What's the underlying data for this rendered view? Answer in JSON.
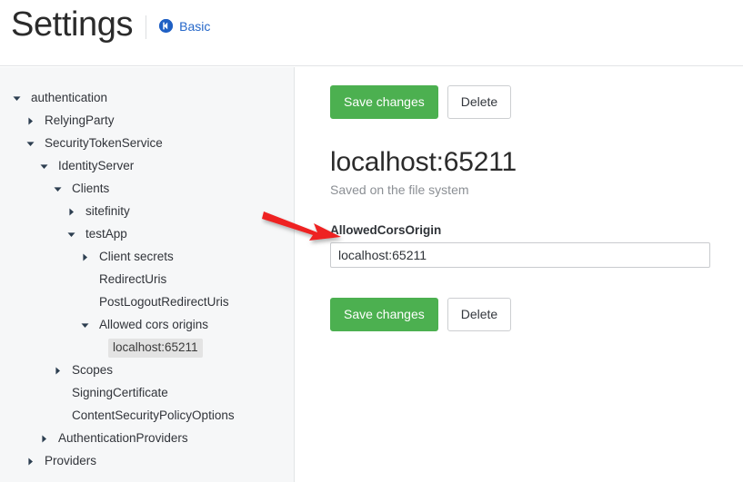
{
  "header": {
    "title": "Settings",
    "back_link": {
      "label": "Basic",
      "icon": "circle-arrow-left-icon"
    }
  },
  "sidebar": {
    "tree": [
      {
        "label": "authentication",
        "depth": 0,
        "state": "expanded",
        "selected": false
      },
      {
        "label": "RelyingParty",
        "depth": 1,
        "state": "collapsed",
        "selected": false
      },
      {
        "label": "SecurityTokenService",
        "depth": 1,
        "state": "expanded",
        "selected": false
      },
      {
        "label": "IdentityServer",
        "depth": 2,
        "state": "expanded",
        "selected": false
      },
      {
        "label": "Clients",
        "depth": 3,
        "state": "expanded",
        "selected": false
      },
      {
        "label": "sitefinity",
        "depth": 4,
        "state": "collapsed",
        "selected": false
      },
      {
        "label": "testApp",
        "depth": 4,
        "state": "expanded",
        "selected": false
      },
      {
        "label": "Client secrets",
        "depth": 5,
        "state": "collapsed",
        "selected": false
      },
      {
        "label": "RedirectUris",
        "depth": 5,
        "state": "leaf",
        "selected": false
      },
      {
        "label": "PostLogoutRedirectUris",
        "depth": 5,
        "state": "leaf",
        "selected": false
      },
      {
        "label": "Allowed cors origins",
        "depth": 5,
        "state": "expanded",
        "selected": false
      },
      {
        "label": "localhost:65211",
        "depth": 6,
        "state": "leaf",
        "selected": true
      },
      {
        "label": "Scopes",
        "depth": 3,
        "state": "collapsed",
        "selected": false
      },
      {
        "label": "SigningCertificate",
        "depth": 3,
        "state": "leaf",
        "selected": false
      },
      {
        "label": "ContentSecurityPolicyOptions",
        "depth": 3,
        "state": "leaf",
        "selected": false
      },
      {
        "label": "AuthenticationProviders",
        "depth": 2,
        "state": "collapsed",
        "selected": false
      },
      {
        "label": "Providers",
        "depth": 1,
        "state": "collapsed",
        "selected": false
      }
    ]
  },
  "main": {
    "top_actions": {
      "save_label": "Save changes",
      "delete_label": "Delete"
    },
    "title": "localhost:65211",
    "subtitle": "Saved on the file system",
    "field": {
      "label": "AllowedCorsOrigin",
      "value": "localhost:65211",
      "placeholder": ""
    },
    "bottom_actions": {
      "save_label": "Save changes",
      "delete_label": "Delete"
    }
  },
  "annotation": {
    "type": "red-arrow",
    "points_to": "allowed-cors-origin-input",
    "color": "#ee2222"
  },
  "colors": {
    "accent_green": "#4cb050",
    "link_blue": "#2567c9",
    "sidebar_bg": "#f6f7f8",
    "selected_bg": "#e3e3e3",
    "annotation_red": "#ee2222"
  }
}
